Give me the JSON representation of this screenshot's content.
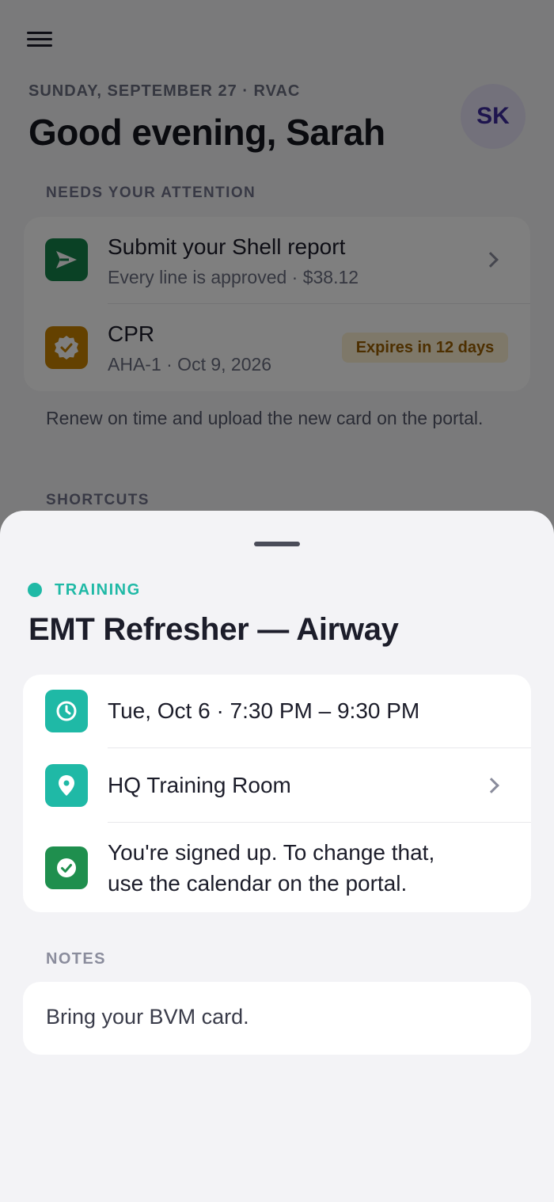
{
  "background": {
    "date_line": "SUNDAY, SEPTEMBER 27 · RVAC",
    "greeting": "Good evening, Sarah",
    "avatar_initials": "SK",
    "attention": {
      "label": "NEEDS YOUR ATTENTION",
      "items": [
        {
          "title": "Submit your Shell report",
          "subtitle": "Every line is approved · $38.12",
          "icon": "send-icon"
        },
        {
          "title": "CPR",
          "subtitle": "AHA-1 · Oct 9, 2026",
          "badge": "Expires in 12 days",
          "icon": "badge-check-icon"
        }
      ],
      "note": "Renew on time and upload the new card on the portal."
    },
    "shortcuts_label": "SHORTCUTS"
  },
  "sheet": {
    "category": "TRAINING",
    "title": "EMT Refresher — Airway",
    "details": {
      "time": "Tue, Oct 6 · 7:30 PM – 9:30 PM",
      "location": "HQ Training Room",
      "status_line1": "You're signed up. To change that,",
      "status_line2": "use the calendar on the portal."
    },
    "notes_label": "NOTES",
    "notes_text": "Bring your BVM card."
  },
  "colors": {
    "teal": "#1fb9a6",
    "green": "#1f8f4e",
    "report_green": "#15824a",
    "amber": "#c98300",
    "avatar_bg": "#e6e2f6"
  }
}
